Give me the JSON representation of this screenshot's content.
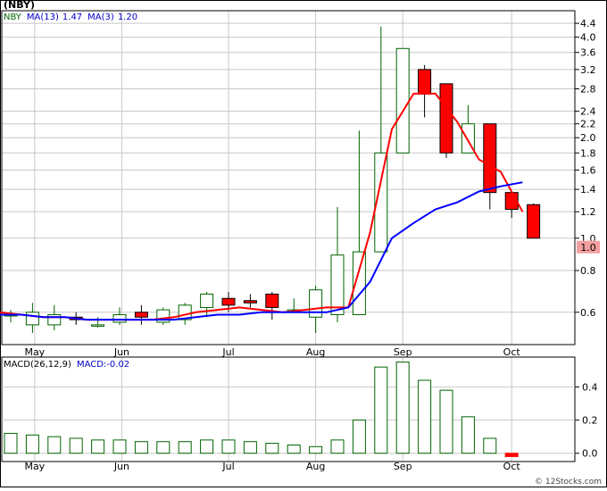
{
  "header": {
    "ticker": "NBY",
    "ticker_label": "(NBY)",
    "ma13_label": "MA(13)",
    "ma13_value": "1.47",
    "ma3_label": "MA(3)",
    "ma3_value": "1.20"
  },
  "macd_header": {
    "label": "MACD(26,12,9)",
    "value_label": "MACD:-0.02"
  },
  "credit": "© 12Stocks.com",
  "colors": {
    "up_candle": "#006400",
    "down_candle": "#ff0000",
    "ma13": "#0000ff",
    "ma3": "#ff0000",
    "grid": "#c8c8c8",
    "last_price_bg": "#f4a0a0",
    "macd_bar": "#006400"
  },
  "chart_data": [
    {
      "type": "candlestick",
      "x": [
        "May wk1",
        "May wk2",
        "May wk3",
        "May wk4",
        "Jun wk1",
        "Jun wk2",
        "Jun wk3",
        "Jun wk4",
        "Jun wk5",
        "Jul wk1",
        "Jul wk2",
        "Jul wk3",
        "Jul wk4",
        "Aug wk1",
        "Aug wk2",
        "Aug wk3",
        "Aug wk4",
        "Sep wk1",
        "Sep wk2",
        "Sep wk3",
        "Sep wk4",
        "Sep wk5",
        "Oct wk1",
        "Oct wk2"
      ],
      "open": [
        0.59,
        0.55,
        0.55,
        0.58,
        0.55,
        0.56,
        0.6,
        0.56,
        0.57,
        0.62,
        0.66,
        0.65,
        0.68,
        0.61,
        0.58,
        0.59,
        0.59,
        0.91,
        1.8,
        3.2,
        2.9,
        1.8,
        2.2,
        1.37,
        1.26
      ],
      "close": [
        0.59,
        0.6,
        0.59,
        0.57,
        0.55,
        0.59,
        0.58,
        0.61,
        0.63,
        0.68,
        0.63,
        0.64,
        0.62,
        0.61,
        0.7,
        0.89,
        0.91,
        1.8,
        3.7,
        2.7,
        1.8,
        2.2,
        1.37,
        1.22,
        1.0
      ],
      "high": [
        0.61,
        0.64,
        0.63,
        0.6,
        0.58,
        0.62,
        0.63,
        0.62,
        0.64,
        0.69,
        0.69,
        0.68,
        0.69,
        0.66,
        0.72,
        1.24,
        2.1,
        4.3,
        3.4,
        3.3,
        2.2,
        2.5,
        1.6,
        1.28,
        1.27
      ],
      "low": [
        0.56,
        0.52,
        0.53,
        0.55,
        0.54,
        0.55,
        0.55,
        0.55,
        0.55,
        0.58,
        0.6,
        0.62,
        0.57,
        0.6,
        0.52,
        0.56,
        0.85,
        1.8,
        2.6,
        2.3,
        1.74,
        1.8,
        1.22,
        1.15,
        1.0
      ],
      "ma13": [
        0.59,
        0.59,
        0.58,
        0.58,
        0.57,
        0.57,
        0.57,
        0.57,
        0.57,
        0.58,
        0.59,
        0.59,
        0.6,
        0.6,
        0.6,
        0.6,
        0.62,
        0.74,
        1.0,
        1.11,
        1.22,
        1.28,
        1.38,
        1.43,
        1.47
      ],
      "ma3": [
        0.6,
        0.59,
        0.58,
        0.58,
        0.57,
        0.57,
        0.57,
        0.57,
        0.58,
        0.6,
        0.61,
        0.62,
        0.61,
        0.6,
        0.61,
        0.62,
        0.62,
        1.04,
        2.12,
        2.71,
        2.71,
        2.23,
        1.72,
        1.58,
        1.2
      ],
      "last_price": "1.0",
      "y_scale": "log",
      "ylim": [
        0.48,
        4.8
      ],
      "y_ticks": [
        "0.6",
        "0.8",
        "1.0",
        "1.2",
        "1.4",
        "1.6",
        "1.8",
        "2.0",
        "2.2",
        "2.4",
        "2.8",
        "3.2",
        "3.6",
        "4.0",
        "4.4"
      ],
      "x_tick_labels": [
        "May",
        "Jun",
        "Jul",
        "Aug",
        "Sep",
        "Oct"
      ],
      "grid": true,
      "legend": "top-left"
    },
    {
      "type": "bar",
      "title": "MACD(26,12,9)",
      "values": [
        0.12,
        0.11,
        0.1,
        0.09,
        0.08,
        0.08,
        0.07,
        0.07,
        0.07,
        0.08,
        0.08,
        0.07,
        0.06,
        0.05,
        0.04,
        0.08,
        0.2,
        0.52,
        0.55,
        0.44,
        0.38,
        0.22,
        0.09,
        -0.02
      ],
      "ylim": [
        -0.05,
        0.58
      ],
      "y_ticks": [
        "0.0",
        "0.2",
        "0.4"
      ],
      "x_tick_labels": [
        "May",
        "Jun",
        "Jul",
        "Aug",
        "Sep",
        "Oct"
      ],
      "grid": true
    }
  ]
}
